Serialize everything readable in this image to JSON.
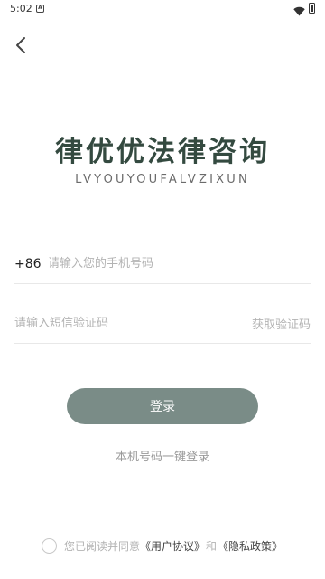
{
  "status_bar": {
    "time": "5:02",
    "notification_icon": "A"
  },
  "icons": {
    "back": "chevron-left-icon",
    "wifi": "wifi-icon",
    "battery": "battery-icon",
    "checkbox": "circle-checkbox-icon"
  },
  "brand": {
    "title": "律优优法律咨询",
    "subtitle": "LVYOUYOUFALVZIXUN",
    "title_color": "#344a40"
  },
  "login_form": {
    "country_code": "+86",
    "phone_placeholder": "请输入您的手机号码",
    "phone_value": "",
    "code_placeholder": "请输入短信验证码",
    "code_value": "",
    "get_code_label": "获取验证码",
    "submit_label": "登录",
    "submit_color": "#7a8c87",
    "one_click_label": "本机号码一键登录"
  },
  "agreement": {
    "checked": false,
    "prefix": "您已阅读并同意",
    "user_agreement": "《用户协议》",
    "and": "和",
    "privacy_policy": "《隐私政策》"
  }
}
